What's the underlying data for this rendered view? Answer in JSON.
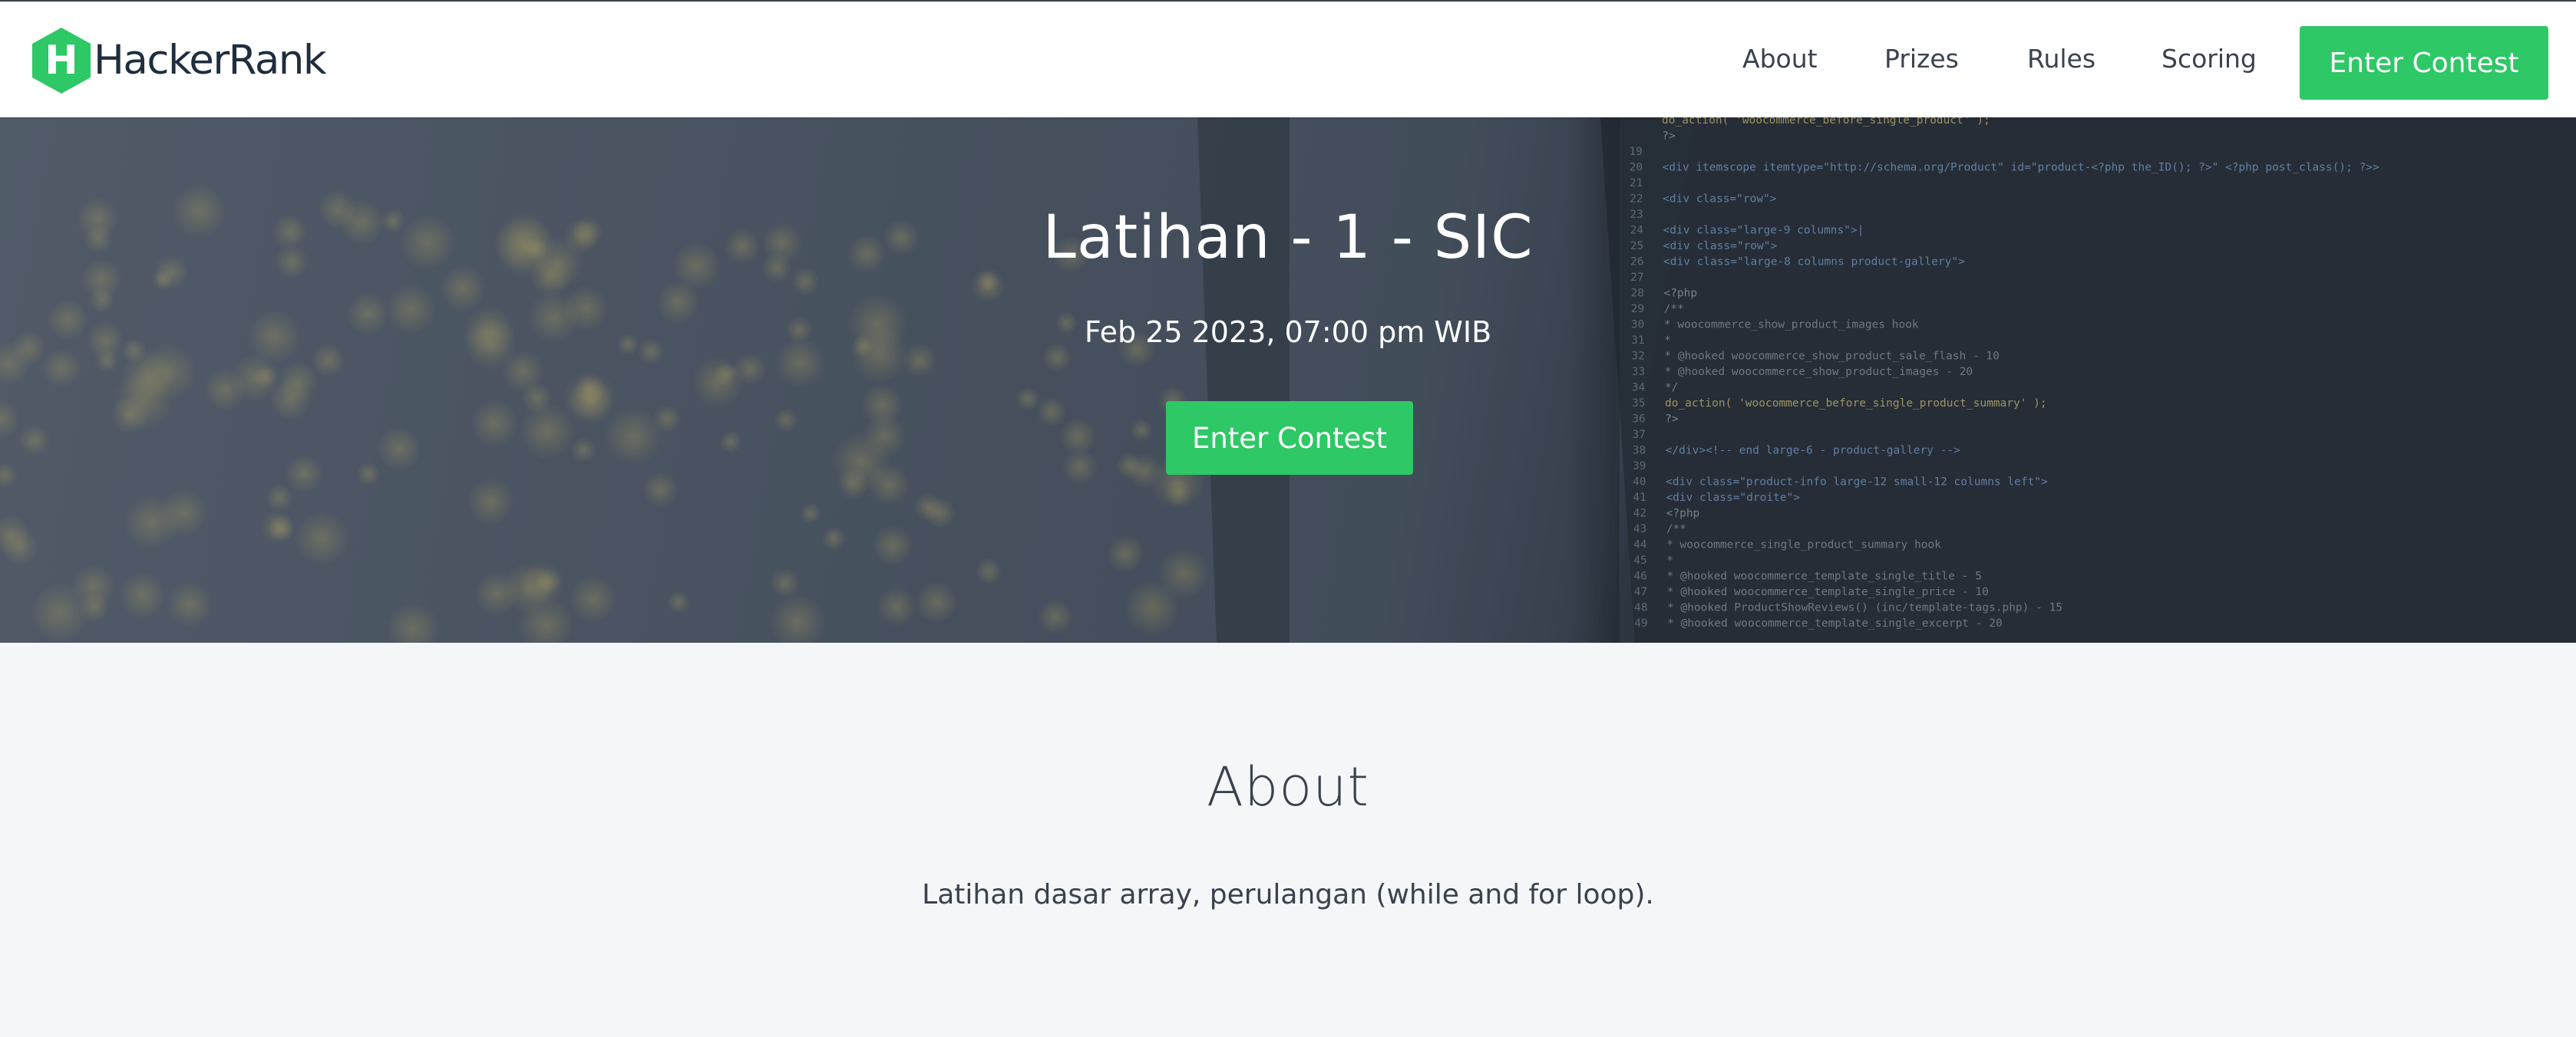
{
  "brand": {
    "name": "HackerRank",
    "logo_letter": "H",
    "accent": "#2ec866"
  },
  "nav": {
    "items": [
      {
        "label": "About"
      },
      {
        "label": "Prizes"
      },
      {
        "label": "Rules"
      },
      {
        "label": "Scoring"
      }
    ],
    "cta_label": "Enter Contest"
  },
  "hero": {
    "title": "Latihan - 1 - SIC",
    "date": "Feb 25 2023, 07:00 pm WIB",
    "cta_label": "Enter Contest"
  },
  "about": {
    "heading": "About",
    "description": "Latihan dasar array, perulangan (while and for loop)."
  },
  "code_lines": [
    {
      "n": "",
      "t": "   do_action( 'woocommerce_before_single_product' );"
    },
    {
      "n": "",
      "t": "?>"
    },
    {
      "n": "19",
      "t": ""
    },
    {
      "n": "20",
      "t": "<div itemscope itemtype=\"http://schema.org/Product\" id=\"product-<?php the_ID(); ?>\" <?php post_class(); ?>>"
    },
    {
      "n": "21",
      "t": ""
    },
    {
      "n": "22",
      "t": "<div class=\"row\">"
    },
    {
      "n": "23",
      "t": ""
    },
    {
      "n": "24",
      "t": "    <div class=\"large-9 columns\">|"
    },
    {
      "n": "25",
      "t": "        <div class=\"row\">"
    },
    {
      "n": "26",
      "t": "            <div class=\"large-8 columns product-gallery\">"
    },
    {
      "n": "27",
      "t": ""
    },
    {
      "n": "28",
      "t": "            <?php"
    },
    {
      "n": "29",
      "t": "                /**"
    },
    {
      "n": "30",
      "t": "                 * woocommerce_show_product_images hook"
    },
    {
      "n": "31",
      "t": "                 *"
    },
    {
      "n": "32",
      "t": "                 * @hooked woocommerce_show_product_sale_flash - 10"
    },
    {
      "n": "33",
      "t": "                 * @hooked woocommerce_show_product_images - 20"
    },
    {
      "n": "34",
      "t": "                 */"
    },
    {
      "n": "35",
      "t": "                do_action( 'woocommerce_before_single_product_summary' );"
    },
    {
      "n": "36",
      "t": "            ?>"
    },
    {
      "n": "37",
      "t": ""
    },
    {
      "n": "38",
      "t": "        </div><!-- end large-6 - product-gallery -->"
    },
    {
      "n": "39",
      "t": ""
    },
    {
      "n": "40",
      "t": "        <div class=\"product-info large-12 small-12 columns left\">"
    },
    {
      "n": "41",
      "t": "         <div class=\"droite\">"
    },
    {
      "n": "42",
      "t": "            <?php"
    },
    {
      "n": "43",
      "t": "                    /**"
    },
    {
      "n": "44",
      "t": "                     * woocommerce_single_product_summary hook"
    },
    {
      "n": "45",
      "t": "                     *"
    },
    {
      "n": "46",
      "t": "                     * @hooked woocommerce_template_single_title - 5"
    },
    {
      "n": "47",
      "t": "                     * @hooked woocommerce_template_single_price - 10"
    },
    {
      "n": "48",
      "t": "                     * @hooked ProductShowReviews() (inc/template-tags.php) - 15"
    },
    {
      "n": "49",
      "t": "                     * @hooked woocommerce_template_single_excerpt - 20"
    }
  ]
}
